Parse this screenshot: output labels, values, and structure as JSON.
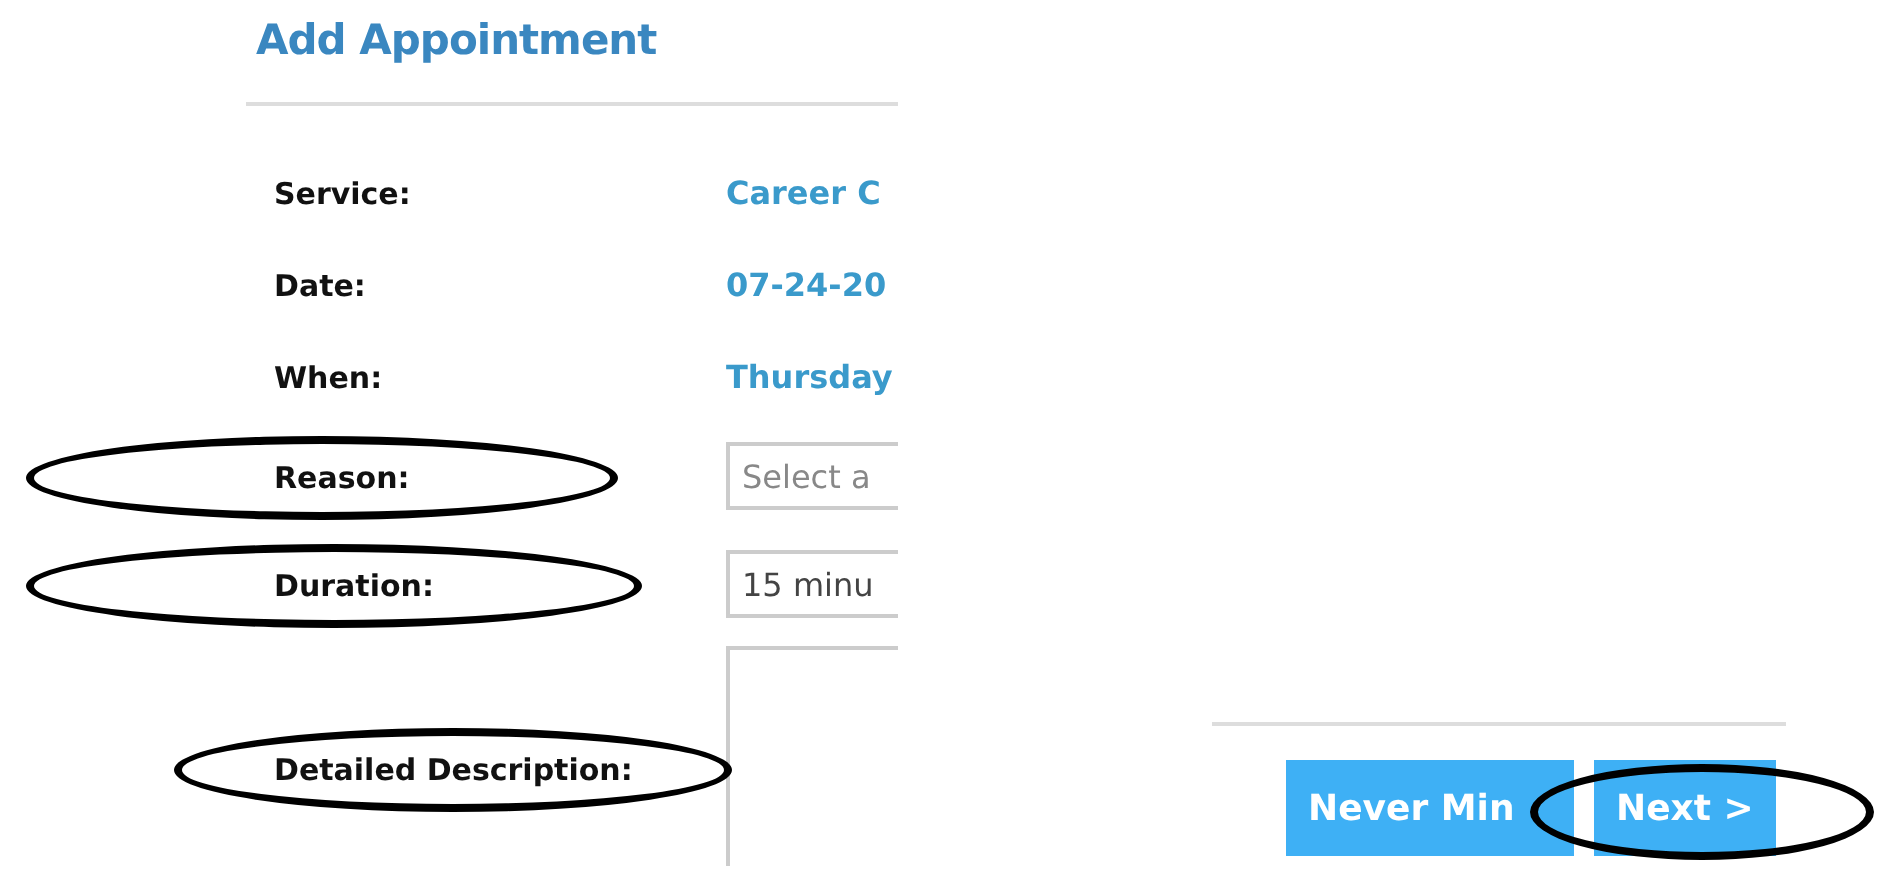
{
  "title": "Add Appointment",
  "details": [
    {
      "label": "Service:",
      "value": "Career C"
    },
    {
      "label": "Date:",
      "value": "07-24-20"
    },
    {
      "label": "When:",
      "value": "Thursday"
    }
  ],
  "fields": [
    {
      "kind": "select",
      "label": "Reason:",
      "placeholder": "Select a",
      "circled": true
    },
    {
      "kind": "select",
      "label": "Duration:",
      "value": "15 minu",
      "circled": true
    },
    {
      "kind": "textarea",
      "label": "Detailed Description:",
      "circled": true
    }
  ],
  "buttons": [
    {
      "label": "Never Min",
      "circled": false
    },
    {
      "label": "Next >",
      "circled": true
    }
  ]
}
